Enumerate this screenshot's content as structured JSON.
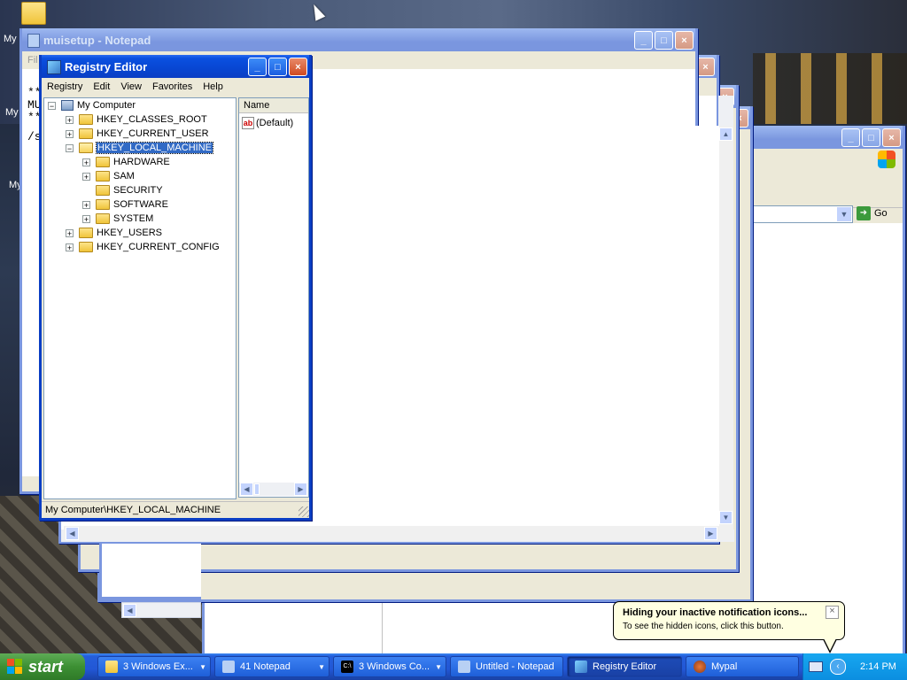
{
  "desktop": {
    "icon_labels": [
      "My",
      "My",
      "My"
    ]
  },
  "notepad_back": {
    "title": "muisetup - Notepad",
    "menu_first": "Fil",
    "text_lines": [
      "**",
      "MU",
      "**",
      "",
      "/s"
    ]
  },
  "regedit": {
    "title": "Registry Editor",
    "menu": [
      "Registry",
      "Edit",
      "View",
      "Favorites",
      "Help"
    ],
    "tree": {
      "root": "My Computer",
      "hkcr": "HKEY_CLASSES_ROOT",
      "hkcu": "HKEY_CURRENT_USER",
      "hklm": "HKEY_LOCAL_MACHINE",
      "hardware": "HARDWARE",
      "sam": "SAM",
      "security": "SECURITY",
      "software": "SOFTWARE",
      "system": "SYSTEM",
      "hku": "HKEY_USERS",
      "hkcc": "HKEY_CURRENT_CONFIG"
    },
    "list_header": "Name",
    "list_value": "(Default)",
    "value_icon_text": "ab",
    "status": "My Computer\\HKEY_LOCAL_MACHINE"
  },
  "explorer_back": {
    "go_label": "Go"
  },
  "balloon": {
    "title": "Hiding your inactive notification icons...",
    "text": "To see the hidden icons, click this button.",
    "close": "×"
  },
  "taskbar": {
    "start": "start",
    "buttons": [
      "3 Windows Ex...",
      "41 Notepad",
      "3 Windows Co...",
      "Untitled - Notepad",
      "Registry Editor",
      "Mypal"
    ],
    "console_icon_text": "C:\\",
    "clock": "2:14 PM"
  },
  "colors": {
    "title_active": "#0a3ec4",
    "selection": "#316ac5",
    "start_green": "#3c8f33"
  }
}
